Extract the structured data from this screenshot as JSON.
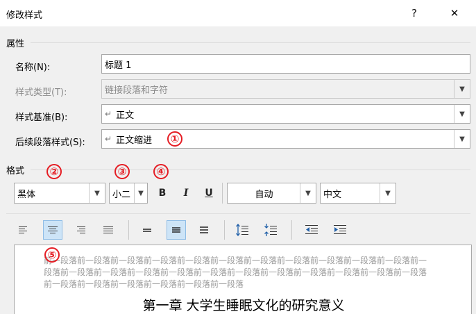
{
  "window": {
    "title": "修改样式",
    "help_label": "?",
    "close_label": "✕"
  },
  "properties": {
    "section_label": "属性",
    "name": {
      "label": "名称(N):",
      "value": "标题 1"
    },
    "style_type": {
      "label": "样式类型(T):",
      "value": "链接段落和字符"
    },
    "based_on": {
      "label": "样式基准(B):",
      "value": "正文"
    },
    "following": {
      "label": "后续段落样式(S):",
      "value": "正文缩进"
    }
  },
  "format": {
    "section_label": "格式",
    "font": "黑体",
    "size": "小二",
    "bold": "B",
    "italic": "I",
    "underline": "U",
    "color": "自动",
    "script": "中文"
  },
  "markers": [
    "①",
    "②",
    "③",
    "④",
    "⑤"
  ],
  "preview": {
    "prev_paragraph": "前一段落前一段落前一段落前一段落前一段落前一段落前一段落前一段落前一段落前一段落前一段落前一段落前一段落前一段落前一段落前一段落前一段落前一段落前一段落前一段落前一段落前一段落前一段落前一段落前一段落前一段落前一段落前一段落前一段落",
    "heading": "第一章 大学生睡眠文化的研究意义"
  },
  "colors": {
    "accent": "#e51c23",
    "active_button": "#cde4f7",
    "dialog_bg": "#f0f0f0"
  },
  "icons": [
    "align-left-icon",
    "align-center-icon",
    "align-right-icon",
    "justify-icon",
    "single-spacing-icon",
    "one-half-spacing-icon",
    "double-spacing-icon",
    "increase-paragraph-spacing-icon",
    "decrease-paragraph-spacing-icon",
    "decrease-indent-icon",
    "increase-indent-icon"
  ]
}
